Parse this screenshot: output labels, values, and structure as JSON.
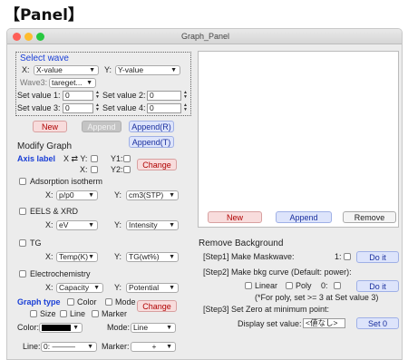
{
  "heading": "【Panel】",
  "window": {
    "title": "Graph_Panel"
  },
  "select_wave": {
    "title": "Select wave",
    "x_label": "X:",
    "x_value": "X-value",
    "y_label": "Y:",
    "y_value": "Y-value",
    "wave3_label": "Wave3:",
    "wave3_value": "tareget...",
    "set1_label": "Set value 1:",
    "set1_value": "0",
    "set2_label": "Set value 2:",
    "set2_value": "0",
    "set3_label": "Set value 3:",
    "set3_value": "0",
    "set4_label": "Set value 4:",
    "set4_value": "0"
  },
  "buttons": {
    "new": "New",
    "append": "Append",
    "append_r": "Append(R)",
    "append_t": "Append(T)",
    "change": "Change",
    "remove": "Remove",
    "do_it": "Do it",
    "set0": "Set 0"
  },
  "modify": {
    "title": "Modify Graph",
    "axis_label": "Axis label",
    "x_swap_y": "X ⇄ Y:",
    "x": "X:",
    "y1": "Y1:",
    "y2": "Y2:",
    "adsorption": "Adsorption isotherm",
    "ads_x": "p/p0",
    "ads_y": "cm3(STP)",
    "eels": "EELS & XRD",
    "eels_x": "eV",
    "eels_y": "Intensity",
    "tg": "TG",
    "tg_x": "Temp(K)",
    "tg_y": "TG(wt%)",
    "electro": "Electrochemistry",
    "ec_x": "Capacity",
    "ec_y": "Potential",
    "x_label": "X:",
    "y_label": "Y:"
  },
  "graph_type": {
    "title": "Graph type",
    "color": "Color",
    "mode": "Mode",
    "size": "Size",
    "line": "Line",
    "marker": "Marker",
    "color_label": "Color:",
    "mode_label": "Mode:",
    "mode_value": "Line",
    "line_label": "Line:",
    "line_value": "0: ———",
    "marker_label": "Marker:",
    "marker_value": "+"
  },
  "remove_bg": {
    "title": "Remove Background",
    "step1": "[Step1] Make Maskwave:",
    "step1_num": "1:",
    "step2": "[Step2] Make bkg curve (Default: power):",
    "linear": "Linear",
    "poly": "Poly",
    "poly_num": "0:",
    "note": "(*For poly, set >= 3 at Set value 3)",
    "step3": "[Step3] Set Zero at minimum point:",
    "display_label": "Display set value:",
    "display_value": "<値なし>"
  },
  "colors": {
    "accent_blue": "#1a3fd6",
    "close": "#fe5f57",
    "minimize": "#febc2e",
    "zoom": "#28c840"
  }
}
